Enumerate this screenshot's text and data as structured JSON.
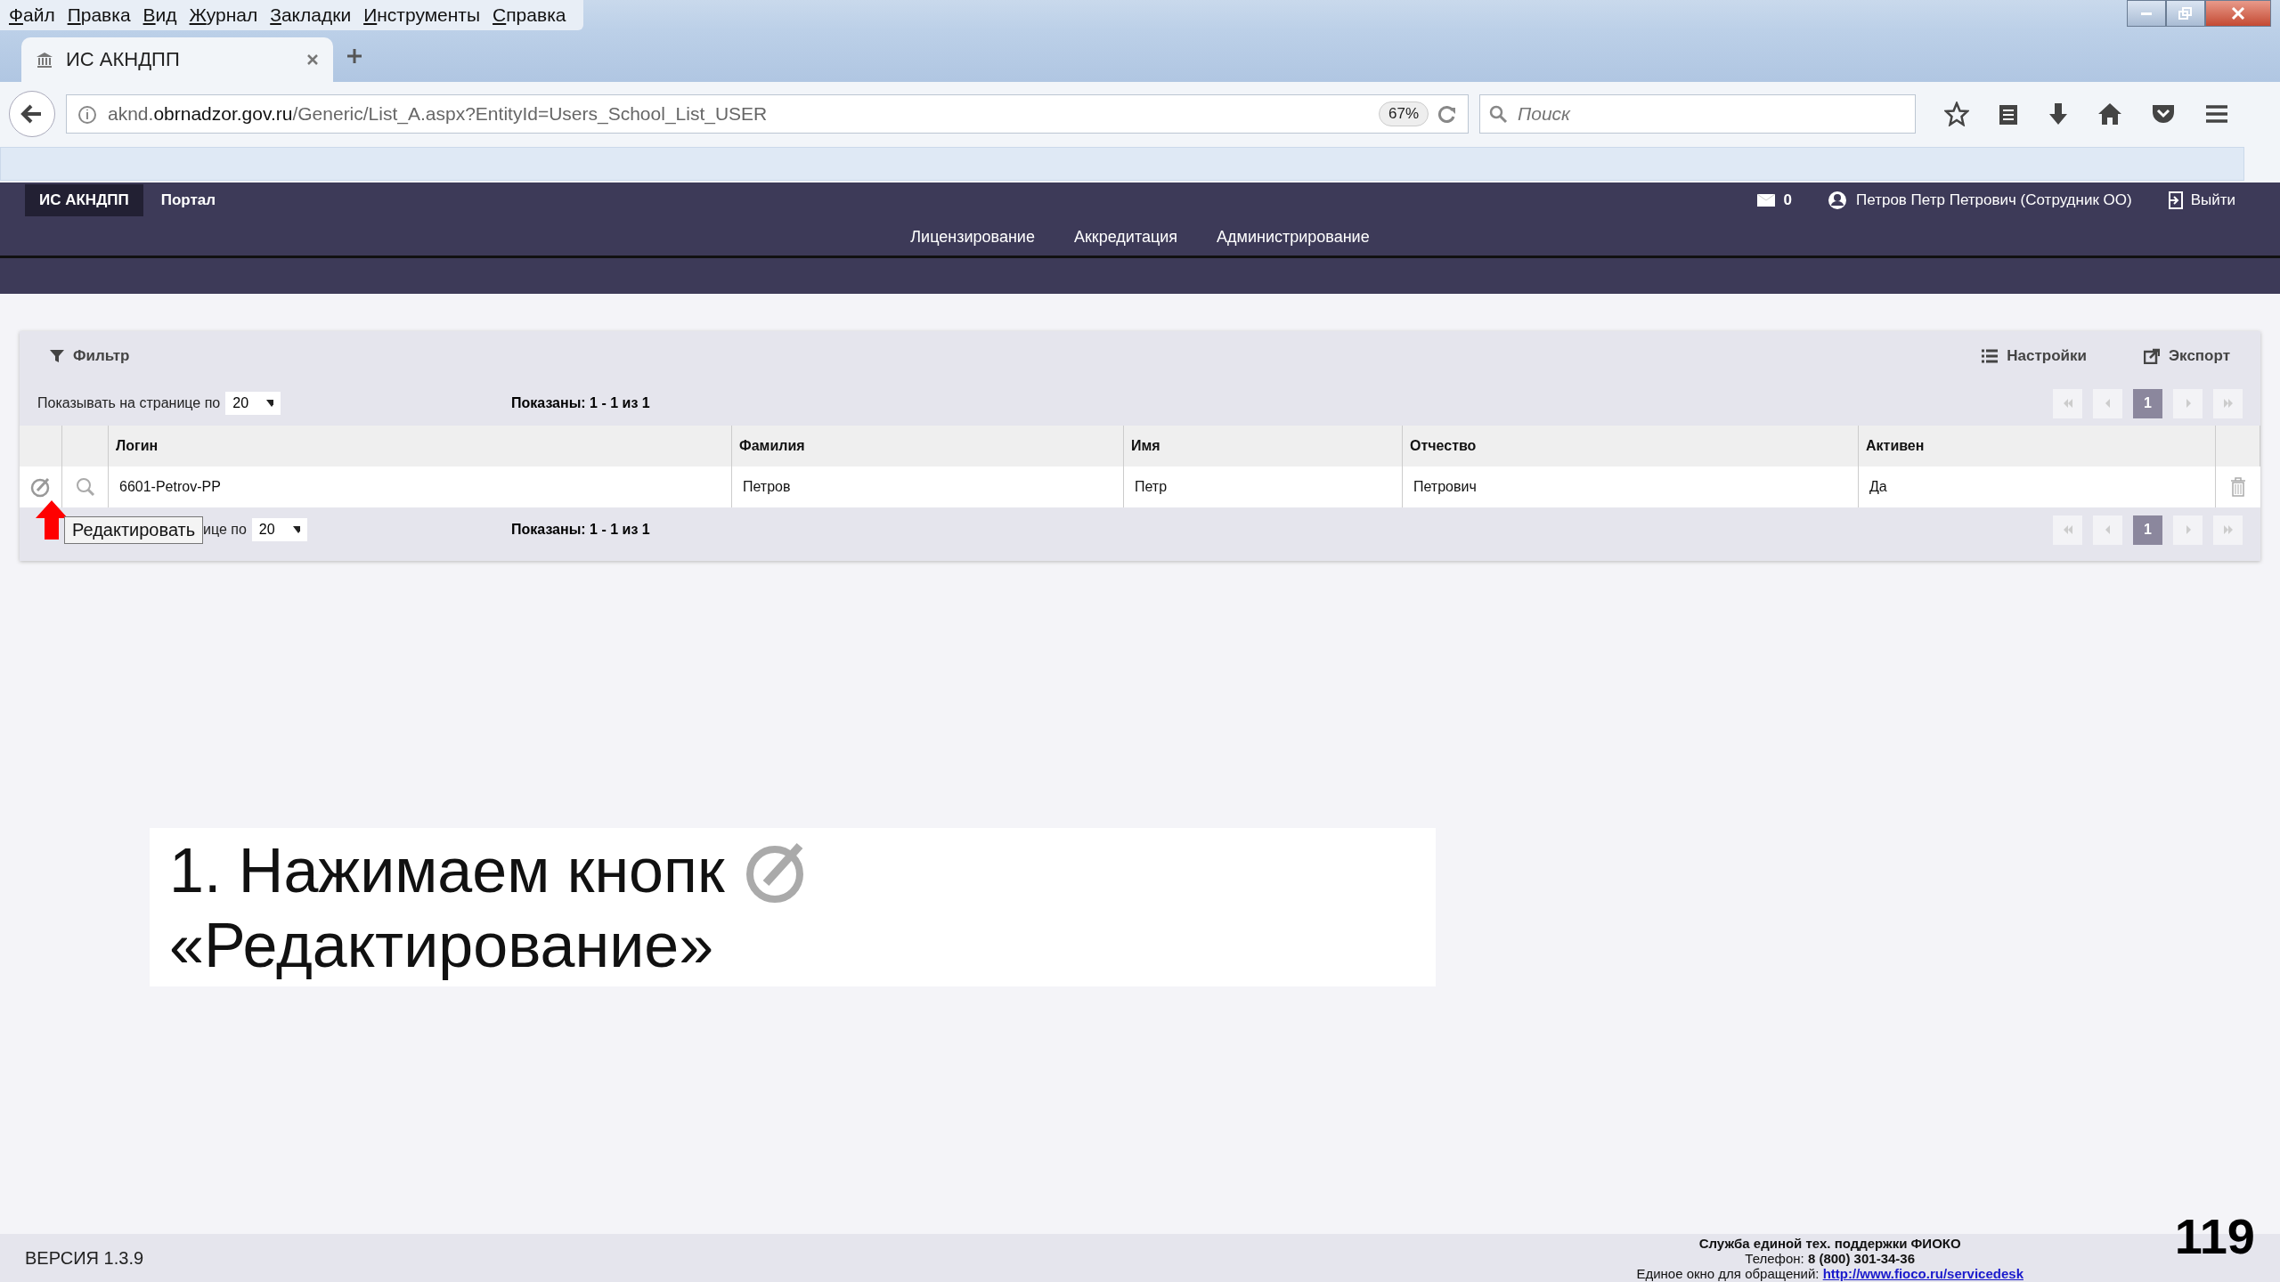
{
  "menu_bar": [
    "Файл",
    "Правка",
    "Вид",
    "Журнал",
    "Закладки",
    "Инструменты",
    "Справка"
  ],
  "tabs": [
    {
      "label": "ИС АКНДПП",
      "selected": true
    }
  ],
  "address_bar": {
    "url_host_prefix": "aknd.",
    "url_host": "obrnadzor.gov.ru",
    "url_path": "/Generic/List_A.aspx?EntityId=Users_School_List_USER",
    "zoom": "67%"
  },
  "search": {
    "placeholder": "Поиск"
  },
  "site_header": {
    "brand": "ИС АКНДПП",
    "portal": "Портал",
    "messages": "0",
    "user": "Петров Петр Петрович (Сотрудник ОО)",
    "logout": "Выйти"
  },
  "site_nav": [
    "Лицензирование",
    "Аккредитация",
    "Администрирование"
  ],
  "toolbar": {
    "filter": "Фильтр",
    "settings": "Настройки",
    "export": "Экспорт"
  },
  "pager_top": {
    "label": "Показывать на странице по",
    "page_size": "20",
    "shown": "Показаны: 1 - 1 из 1",
    "pages": [
      {
        "label": "1",
        "selected": true
      }
    ]
  },
  "table": {
    "columns": [
      "Логин",
      "Фамилия",
      "Имя",
      "Отчество",
      "Активен"
    ],
    "rows": [
      {
        "cells": [
          "6601-Petrov-PP",
          "Петров",
          "Петр",
          "Петрович",
          "Да"
        ]
      }
    ]
  },
  "tooltip": "Редактировать",
  "pager_bottom": {
    "label": "ице по",
    "page_size": "20",
    "shown": "Показаны: 1 - 1 из 1",
    "pages": [
      {
        "label": "1",
        "selected": true
      }
    ]
  },
  "annotation": {
    "text_before_icon": "1. Нажимаем кнопк",
    "text_after_icon": "«Редактирование»"
  },
  "footer": {
    "version": "ВЕРСИЯ 1.3.9",
    "support_title": "Служба единой тех. поддержки ФИОКО",
    "phone_label": "Телефон:",
    "phone": "8 (800) 301-34-36",
    "window_label": "Единое окно для обращений:",
    "link": "http://www.fioco.ru/servicedesk"
  },
  "slide_number": "119"
}
